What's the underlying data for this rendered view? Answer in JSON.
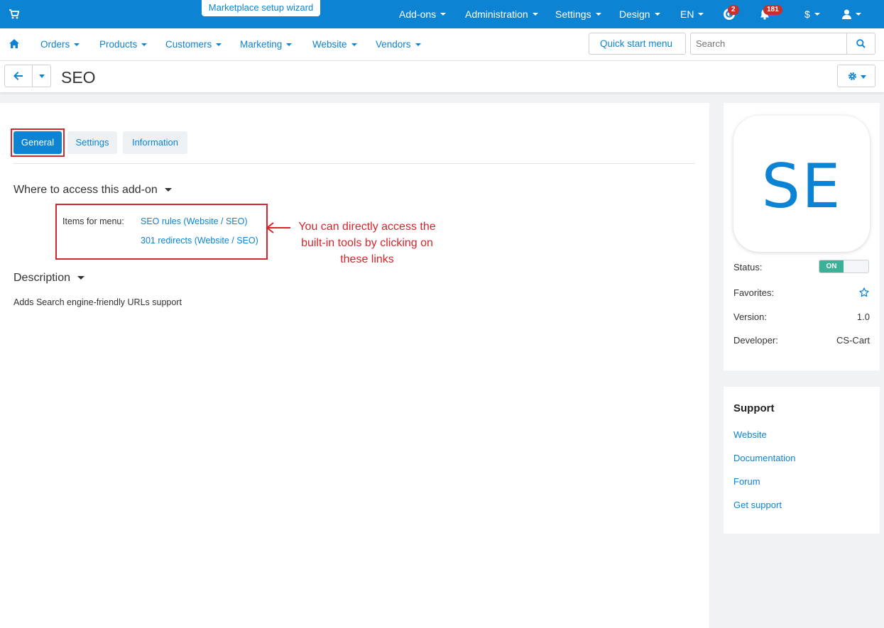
{
  "topbar": {
    "wizard_label": "Marketplace setup wizard",
    "menu": [
      {
        "label": "Add-ons"
      },
      {
        "label": "Administration"
      },
      {
        "label": "Settings"
      },
      {
        "label": "Design"
      },
      {
        "label": "EN"
      }
    ],
    "badge_g": "2",
    "badge_bell": "181",
    "currency": "$"
  },
  "mainnav": {
    "items": [
      {
        "label": "Orders"
      },
      {
        "label": "Products"
      },
      {
        "label": "Customers"
      },
      {
        "label": "Marketing"
      },
      {
        "label": "Website"
      },
      {
        "label": "Vendors"
      }
    ],
    "quick_start": "Quick start menu",
    "search_placeholder": "Search"
  },
  "page": {
    "title": "SEO",
    "tabs": [
      {
        "label": "General",
        "active": true
      },
      {
        "label": "Settings"
      },
      {
        "label": "Information"
      }
    ],
    "access_heading": "Where to access this add-on",
    "items_label": "Items for menu:",
    "access_links": [
      "SEO rules (Website / SEO)",
      "301 redirects (Website / SEO)"
    ],
    "annotation": "You can directly access the built-in tools by clicking on these links",
    "description_heading": "Description",
    "description_text": "Adds Search engine-friendly URLs support"
  },
  "sidebar": {
    "logo_text": "SE",
    "status_label": "Status:",
    "status_value": "ON",
    "favorites_label": "Favorites:",
    "version_label": "Version:",
    "version_value": "1.0",
    "developer_label": "Developer:",
    "developer_value": "CS-Cart",
    "support_heading": "Support",
    "support_links": [
      "Website",
      "Documentation",
      "Forum",
      "Get support"
    ]
  },
  "colors": {
    "primary": "#0d83d3",
    "annotation_red": "#d6252c",
    "toggle_on": "#3bb197"
  }
}
